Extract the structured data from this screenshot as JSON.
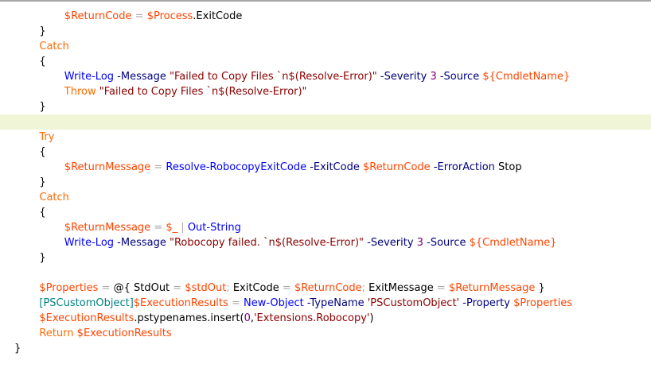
{
  "colors": {
    "background": "#ffffff",
    "current_line": "#f0f5d7",
    "top_border": "#a7a7a7",
    "token_types": {
      "plain": "#000000",
      "var": "#ff4500",
      "cmd": "#0000ff",
      "param": "#000080",
      "op": "#a9a9a9",
      "kw": "#ff6a00",
      "str": "#8b0000",
      "num": "#800080",
      "type": "#008080",
      "member": "#000000"
    }
  },
  "code_lines": [
    {
      "indent": 8,
      "tokens": [
        [
          "var",
          "$ReturnCode"
        ],
        [
          "plain",
          " "
        ],
        [
          "op",
          "="
        ],
        [
          "plain",
          " "
        ],
        [
          "var",
          "$Process"
        ],
        [
          "plain",
          "."
        ],
        [
          "member",
          "ExitCode"
        ]
      ]
    },
    {
      "indent": 4,
      "tokens": [
        [
          "plain",
          "}"
        ]
      ]
    },
    {
      "indent": 4,
      "tokens": [
        [
          "kw",
          "Catch"
        ]
      ]
    },
    {
      "indent": 4,
      "tokens": [
        [
          "plain",
          "{"
        ]
      ]
    },
    {
      "indent": 8,
      "tokens": [
        [
          "cmd",
          "Write-Log"
        ],
        [
          "plain",
          " "
        ],
        [
          "param",
          "-Message"
        ],
        [
          "plain",
          " "
        ],
        [
          "str",
          "\"Failed to Copy Files `n$(Resolve-Error)\""
        ],
        [
          "plain",
          " "
        ],
        [
          "param",
          "-Severity"
        ],
        [
          "plain",
          " "
        ],
        [
          "num",
          "3"
        ],
        [
          "plain",
          " "
        ],
        [
          "param",
          "-Source"
        ],
        [
          "plain",
          " "
        ],
        [
          "var",
          "${CmdletName}"
        ]
      ]
    },
    {
      "indent": 8,
      "tokens": [
        [
          "kw",
          "Throw"
        ],
        [
          "plain",
          " "
        ],
        [
          "str",
          "\"Failed to Copy Files `n$(Resolve-Error)\""
        ]
      ]
    },
    {
      "indent": 4,
      "tokens": [
        [
          "plain",
          "}"
        ]
      ]
    },
    {
      "indent": 0,
      "current": true,
      "tokens": []
    },
    {
      "indent": 4,
      "tokens": [
        [
          "kw",
          "Try"
        ]
      ]
    },
    {
      "indent": 4,
      "tokens": [
        [
          "plain",
          "{"
        ]
      ]
    },
    {
      "indent": 8,
      "tokens": [
        [
          "var",
          "$ReturnMessage"
        ],
        [
          "plain",
          " "
        ],
        [
          "op",
          "="
        ],
        [
          "plain",
          " "
        ],
        [
          "cmd",
          "Resolve-RobocopyExitCode"
        ],
        [
          "plain",
          " "
        ],
        [
          "param",
          "-ExitCode"
        ],
        [
          "plain",
          " "
        ],
        [
          "var",
          "$ReturnCode"
        ],
        [
          "plain",
          " "
        ],
        [
          "param",
          "-ErrorAction"
        ],
        [
          "plain",
          " "
        ],
        [
          "plain",
          "Stop"
        ]
      ]
    },
    {
      "indent": 4,
      "tokens": [
        [
          "plain",
          "}"
        ]
      ]
    },
    {
      "indent": 4,
      "tokens": [
        [
          "kw",
          "Catch"
        ]
      ]
    },
    {
      "indent": 4,
      "tokens": [
        [
          "plain",
          "{"
        ]
      ]
    },
    {
      "indent": 8,
      "tokens": [
        [
          "var",
          "$ReturnMessage"
        ],
        [
          "plain",
          " "
        ],
        [
          "op",
          "="
        ],
        [
          "plain",
          " "
        ],
        [
          "var",
          "$_"
        ],
        [
          "plain",
          " "
        ],
        [
          "op",
          "|"
        ],
        [
          "plain",
          " "
        ],
        [
          "cmd",
          "Out-String"
        ]
      ]
    },
    {
      "indent": 8,
      "tokens": [
        [
          "cmd",
          "Write-Log"
        ],
        [
          "plain",
          " "
        ],
        [
          "param",
          "-Message"
        ],
        [
          "plain",
          " "
        ],
        [
          "str",
          "\"Robocopy failed. `n$(Resolve-Error)\""
        ],
        [
          "plain",
          " "
        ],
        [
          "param",
          "-Severity"
        ],
        [
          "plain",
          " "
        ],
        [
          "num",
          "3"
        ],
        [
          "plain",
          " "
        ],
        [
          "param",
          "-Source"
        ],
        [
          "plain",
          " "
        ],
        [
          "var",
          "${CmdletName}"
        ]
      ]
    },
    {
      "indent": 4,
      "tokens": [
        [
          "plain",
          "}"
        ]
      ]
    },
    {
      "indent": 0,
      "tokens": []
    },
    {
      "indent": 4,
      "tokens": [
        [
          "var",
          "$Properties"
        ],
        [
          "plain",
          " "
        ],
        [
          "op",
          "="
        ],
        [
          "plain",
          " "
        ],
        [
          "plain",
          "@{"
        ],
        [
          "plain",
          " "
        ],
        [
          "plain",
          "StdOut"
        ],
        [
          "plain",
          " "
        ],
        [
          "op",
          "="
        ],
        [
          "plain",
          " "
        ],
        [
          "var",
          "$stdOut"
        ],
        [
          "op",
          ";"
        ],
        [
          "plain",
          " "
        ],
        [
          "plain",
          "ExitCode"
        ],
        [
          "plain",
          " "
        ],
        [
          "op",
          "="
        ],
        [
          "plain",
          " "
        ],
        [
          "var",
          "$ReturnCode"
        ],
        [
          "op",
          ";"
        ],
        [
          "plain",
          " "
        ],
        [
          "plain",
          "ExitMessage"
        ],
        [
          "plain",
          " "
        ],
        [
          "op",
          "="
        ],
        [
          "plain",
          " "
        ],
        [
          "var",
          "$ReturnMessage"
        ],
        [
          "plain",
          " "
        ],
        [
          "plain",
          "}"
        ]
      ]
    },
    {
      "indent": 4,
      "tokens": [
        [
          "type",
          "[PSCustomObject]"
        ],
        [
          "var",
          "$ExecutionResults"
        ],
        [
          "plain",
          " "
        ],
        [
          "op",
          "="
        ],
        [
          "plain",
          " "
        ],
        [
          "cmd",
          "New-Object"
        ],
        [
          "plain",
          " "
        ],
        [
          "param",
          "-TypeName"
        ],
        [
          "plain",
          " "
        ],
        [
          "str",
          "'PSCustomObject'"
        ],
        [
          "plain",
          " "
        ],
        [
          "param",
          "-Property"
        ],
        [
          "plain",
          " "
        ],
        [
          "var",
          "$Properties"
        ]
      ]
    },
    {
      "indent": 4,
      "tokens": [
        [
          "var",
          "$ExecutionResults"
        ],
        [
          "plain",
          "."
        ],
        [
          "member",
          "pstypenames"
        ],
        [
          "plain",
          "."
        ],
        [
          "member",
          "insert"
        ],
        [
          "plain",
          "("
        ],
        [
          "num",
          "0"
        ],
        [
          "plain",
          ","
        ],
        [
          "str",
          "'Extensions.Robocopy'"
        ],
        [
          "plain",
          ")"
        ]
      ]
    },
    {
      "indent": 4,
      "tokens": [
        [
          "kw",
          "Return"
        ],
        [
          "plain",
          " "
        ],
        [
          "var",
          "$ExecutionResults"
        ]
      ]
    },
    {
      "indent": 0,
      "tokens": [
        [
          "plain",
          "}"
        ]
      ]
    }
  ]
}
